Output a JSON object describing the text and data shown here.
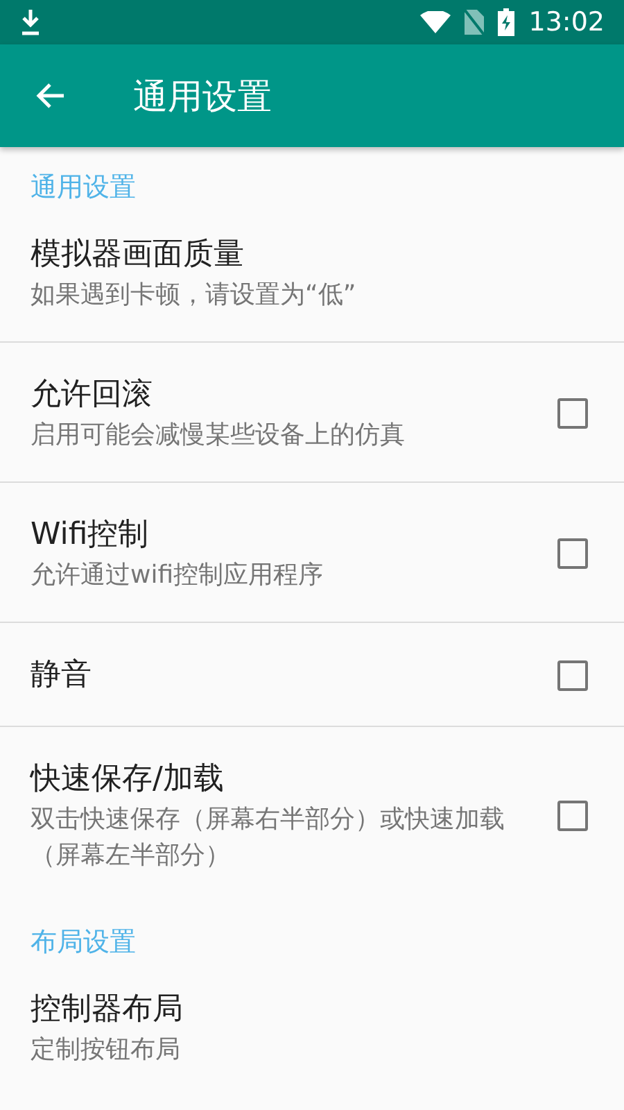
{
  "status_bar": {
    "time": "13:02"
  },
  "app_bar": {
    "title": "通用设置"
  },
  "sections": [
    {
      "header": "通用设置",
      "items": [
        {
          "kind": "plain",
          "title": "模拟器画面质量",
          "summary": "如果遇到卡顿，请设置为“低”"
        },
        {
          "kind": "checkbox",
          "title": "允许回滚",
          "summary": "启用可能会减慢某些设备上的仿真",
          "checked": false
        },
        {
          "kind": "checkbox",
          "title": "Wifi控制",
          "summary": "允许通过wifi控制应用程序",
          "checked": false
        },
        {
          "kind": "checkbox",
          "title": "静音",
          "checked": false
        },
        {
          "kind": "checkbox",
          "title": "快速保存/加载",
          "summary": "双击快速保存（屏幕右半部分）或快速加载（屏幕左半部分）",
          "checked": false
        }
      ]
    },
    {
      "header": "布局设置",
      "items": [
        {
          "kind": "plain",
          "title": "控制器布局",
          "summary": "定制按钮布局"
        }
      ]
    }
  ]
}
